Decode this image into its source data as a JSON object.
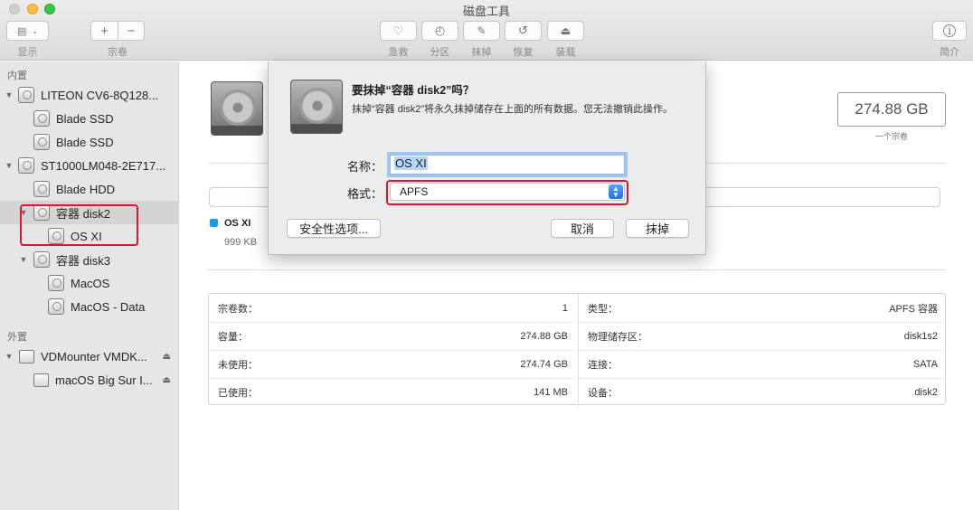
{
  "window": {
    "title": "磁盘工具"
  },
  "toolbar": {
    "view_label": "显示",
    "volume_label": "宗卷",
    "volume_add": "+",
    "volume_remove": "−",
    "actions": [
      {
        "label": "急救",
        "icon": "stethoscope-icon"
      },
      {
        "label": "分区",
        "icon": "pie-icon"
      },
      {
        "label": "抹掉",
        "icon": "erase-icon"
      },
      {
        "label": "恢复",
        "icon": "restore-icon"
      },
      {
        "label": "装载",
        "icon": "mount-icon"
      }
    ],
    "info_label": "简介"
  },
  "sidebar": {
    "internal_header": "内置",
    "external_header": "外置",
    "items": [
      {
        "label": "LITEON CV6-8Q128..."
      },
      {
        "label": "Blade SSD"
      },
      {
        "label": "Blade SSD"
      },
      {
        "label": "ST1000LM048-2E717..."
      },
      {
        "label": "Blade HDD"
      },
      {
        "label": "容器 disk2"
      },
      {
        "label": "OS XI"
      },
      {
        "label": "容器 disk3"
      },
      {
        "label": "MacOS"
      },
      {
        "label": "MacOS - Data"
      },
      {
        "label": "VDMounter VMDK..."
      },
      {
        "label": "macOS Big Sur I..."
      }
    ]
  },
  "main": {
    "capacity": "274.88 GB",
    "capacity_sub": "一个宗卷",
    "legend": {
      "name": "OS XI",
      "size": "999 KB",
      "color": "#1a9bf0"
    },
    "info_left": [
      {
        "key": "宗卷数：",
        "value": "1"
      },
      {
        "key": "容量：",
        "value": "274.88 GB"
      },
      {
        "key": "未使用：",
        "value": "274.74 GB"
      },
      {
        "key": "已使用：",
        "value": "141 MB"
      }
    ],
    "info_right": [
      {
        "key": "类型：",
        "value": "APFS 容器"
      },
      {
        "key": "物理储存区：",
        "value": "disk1s2"
      },
      {
        "key": "连接：",
        "value": "SATA"
      },
      {
        "key": "设备：",
        "value": "disk2"
      }
    ]
  },
  "dialog": {
    "title": "要抹掉“容器 disk2”吗？",
    "message": "抹掉“容器 disk2”将永久抹掉储存在上面的所有数据。您无法撤销此操作。",
    "name_label": "名称：",
    "name_value": "OS XI",
    "format_label": "格式：",
    "format_value": "APFS",
    "security_button": "安全性选项...",
    "cancel_button": "取消",
    "erase_button": "抹掉"
  },
  "colors": {
    "accent": "#1d6ff2",
    "highlight_box": "#e3132b"
  }
}
